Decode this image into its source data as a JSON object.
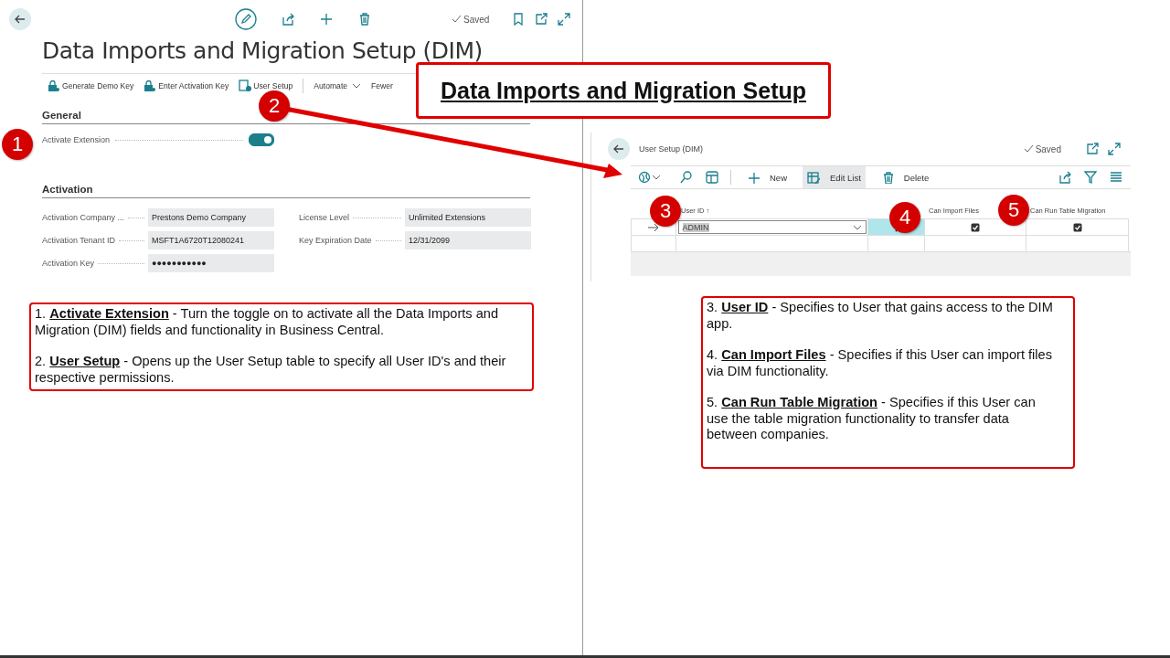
{
  "main_page": {
    "status": "Saved",
    "title": "Data Imports and Migration Setup (DIM)",
    "actions": [
      {
        "label": "Generate Demo Key",
        "kind": "key"
      },
      {
        "label": "Enter Activation Key",
        "kind": "key"
      },
      {
        "label": "User Setup",
        "kind": "users"
      },
      {
        "label": "Automate",
        "kind": "dropdown"
      },
      {
        "label": "Fewer",
        "kind": "plain"
      }
    ],
    "general": {
      "heading": "General",
      "fields": [
        {
          "label": "Activate Extension",
          "kind": "toggle",
          "on": true
        }
      ]
    },
    "activation": {
      "heading": "Activation",
      "fields": [
        {
          "label": "Activation Company ...",
          "value": "Prestons Demo Company"
        },
        {
          "label": "License Level",
          "value": "Unlimited Extensions"
        },
        {
          "label": "Activation Tenant ID",
          "value": "MSFT1A6720T12080241"
        },
        {
          "label": "Key Expiration Date",
          "value": "12/31/2099"
        },
        {
          "label": "Activation Key",
          "value": "●●●●●●●●●●●"
        }
      ]
    }
  },
  "user_setup": {
    "title": "User Setup (DIM)",
    "status": "Saved",
    "actions": [
      {
        "label": "New",
        "kind": "new",
        "selected": false
      },
      {
        "label": "Edit List",
        "kind": "edit",
        "selected": true
      },
      {
        "label": "Delete",
        "kind": "delete",
        "selected": false
      }
    ],
    "columns": [
      "User ID ↑",
      "Can Import Files",
      "Can Run Table Migration"
    ],
    "rows": [
      {
        "user_id": "ADMIN",
        "can_import_files": true,
        "can_run_table_migration": true,
        "selected": true
      }
    ]
  },
  "callout_title": "Data Imports and Migration Setup",
  "notes_left": [
    {
      "number": "1.",
      "term": "Activate Extension",
      "text": " - Turn the toggle on to activate all the Data Imports and Migration (DIM) fields and functionality in Business Central."
    },
    {
      "number": "2.",
      "term": "User Setup",
      "text": " - Opens up the User Setup table to specify all User ID's and their respective permissions."
    }
  ],
  "notes_right": [
    {
      "number": "3.",
      "term": "User ID",
      "text": " - Specifies to User that gains access to the DIM app."
    },
    {
      "number": "4.",
      "term": "Can Import Files",
      "text": " - Specifies if this User can import files via DIM functionality."
    },
    {
      "number": "5.",
      "term": "Can Run Table Migration",
      "text": " - Specifies if this User can use the table migration functionality to transfer data between companies."
    }
  ],
  "markers": [
    "1",
    "2",
    "3",
    "4",
    "5"
  ]
}
